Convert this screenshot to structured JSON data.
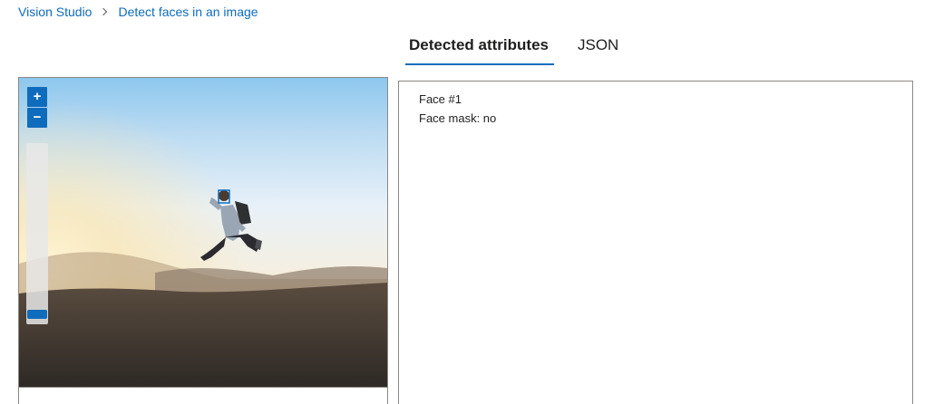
{
  "breadcrumb": {
    "root": "Vision Studio",
    "current": "Detect faces in an image",
    "separator_icon": "chevron-right-icon"
  },
  "tabs": [
    {
      "label": "Detected attributes",
      "active": true
    },
    {
      "label": "JSON",
      "active": false
    }
  ],
  "image_viewer": {
    "zoom_in_label": "+",
    "zoom_out_label": "−",
    "zoom_level": 0,
    "image_description_icon": "photo-jumping-person",
    "face_box_color": "#0f6cbd"
  },
  "attributes": {
    "face_title": "Face #1",
    "face_mask_line": "Face mask: no"
  },
  "colors": {
    "accent": "#0f6cbd",
    "text": "#201f1e",
    "border": "#8a8886"
  }
}
